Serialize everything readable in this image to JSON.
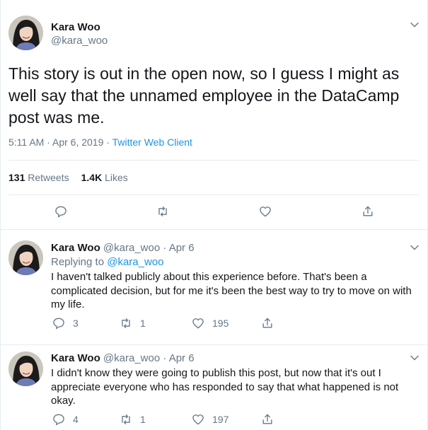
{
  "main_tweet": {
    "author_name": "Kara Woo",
    "author_handle": "@kara_woo",
    "text": "This story is out in the open now, so I guess I might as well say that the unnamed employee in the DataCamp post was me.",
    "timestamp": "5:11 AM · Apr 6, 2019 · ",
    "client": "Twitter Web Client",
    "retweets_count": "131",
    "retweets_label": " Retweets",
    "likes_count": "1.4K",
    "likes_label": " Likes"
  },
  "replies": [
    {
      "author_name": "Kara Woo",
      "author_handle": "@kara_woo",
      "date": " · Apr 6",
      "replying_label": "Replying to ",
      "replying_to": "@kara_woo",
      "text": "I haven't talked publicly about this experience before. That's been a complicated decision, but for me it's been the best way to try to move on with my life.",
      "reply_count": "3",
      "retweet_count": "1",
      "like_count": "195"
    },
    {
      "author_name": "Kara Woo",
      "author_handle": "@kara_woo",
      "date": " · Apr 6",
      "text": "I didn't know they were going to publish this post, but now that it's out I appreciate everyone who has responded to say that what happened is not okay.",
      "reply_count": "4",
      "retweet_count": "1",
      "like_count": "197"
    }
  ],
  "icons": {
    "reply": "speech-bubble",
    "retweet": "two-arrows-loop",
    "like": "heart-outline",
    "share": "upload-arrow",
    "menu": "chevron-down"
  },
  "colors": {
    "link": "#1b95e0",
    "secondary_text": "#657786",
    "divider": "#e6ecf0"
  }
}
